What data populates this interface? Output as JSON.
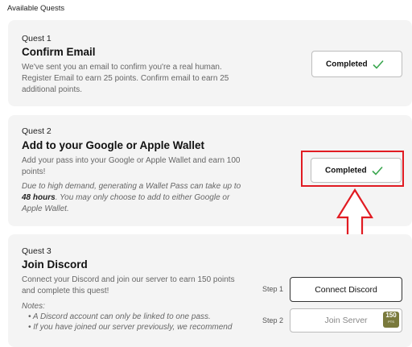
{
  "header": {
    "section_title": "Available Quests"
  },
  "quests": [
    {
      "number": "Quest 1",
      "title": "Confirm Email",
      "description_lines": [
        "We've sent you an email to confirm you're a real human.",
        "Register Email to earn 25 points. Confirm email to earn 25",
        "additional points."
      ],
      "status": "Completed"
    },
    {
      "number": "Quest 2",
      "title": "Add to your Google or Apple Wallet",
      "description_lines": [
        "Add your pass into your Google or Apple Wallet and earn 100",
        "points!"
      ],
      "note_line1": "Due to high demand, generating a Wallet Pass can take up to",
      "note_bold": "48 hours",
      "note_line2_rest": ". You may only choose to add to either Google or",
      "note_line3": "Apple Wallet.",
      "status": "Completed"
    },
    {
      "number": "Quest 3",
      "title": "Join Discord",
      "description_lines": [
        "Connect your Discord and join our server to earn 150 points",
        "and complete this quest!"
      ],
      "notes_title": "Notes:",
      "notes": [
        "• A Discord account can only be linked to one pass.",
        "• If you have joined our server previously, we recommend"
      ],
      "step1_label": "Step 1",
      "step1_button": "Connect Discord",
      "step2_label": "Step 2",
      "step2_button": "Join Server",
      "points_badge": {
        "value": "150",
        "unit": "PTS"
      }
    }
  ],
  "colors": {
    "check": "#3aa64f",
    "highlight": "#e11b22",
    "card_bg": "#f4f4f4"
  },
  "icons": {
    "status_check": "checkmark-icon",
    "annotation_arrow": "up-arrow-icon"
  }
}
